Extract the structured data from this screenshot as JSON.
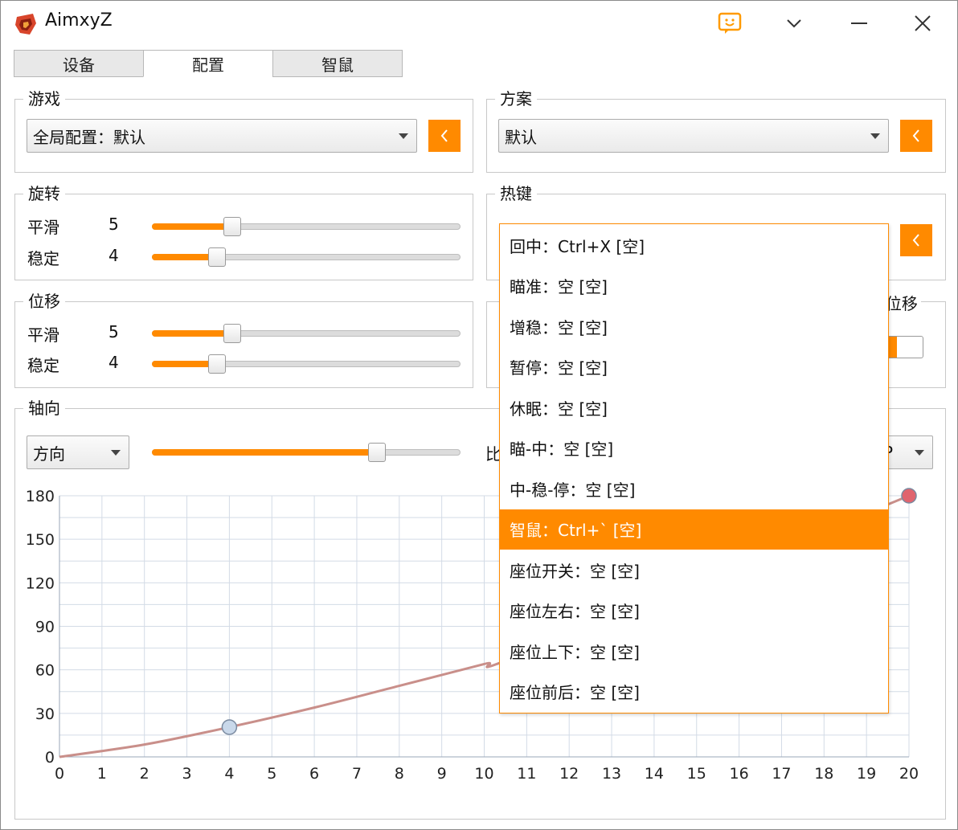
{
  "app": {
    "title": "AimxyZ"
  },
  "tabs": [
    {
      "label": "设备",
      "active": false
    },
    {
      "label": "配置",
      "active": true
    },
    {
      "label": "智鼠",
      "active": false
    }
  ],
  "game": {
    "title": "游戏",
    "selected": "全局配置：默认"
  },
  "scheme": {
    "title": "方案",
    "selected": "默认"
  },
  "rotation": {
    "title": "旋转",
    "rows": [
      {
        "label": "平滑",
        "value": "5",
        "fraction": 0.26
      },
      {
        "label": "稳定",
        "value": "4",
        "fraction": 0.21
      }
    ]
  },
  "hotkeys": {
    "title": "热键"
  },
  "displacement": {
    "title": "位移",
    "rows": [
      {
        "label": "平滑",
        "value": "5",
        "fraction": 0.26
      },
      {
        "label": "稳定",
        "value": "4",
        "fraction": 0.21
      }
    ]
  },
  "hidden_group": {
    "partial_title": "t位移"
  },
  "axis": {
    "title": "轴向",
    "mode": "方向",
    "slider_fraction": 0.73,
    "ratio_label_partial": "比",
    "right_combo_partial": "P"
  },
  "hotkey_list": {
    "selected_index": 7,
    "items": [
      "回中：Ctrl+X [空]",
      "瞄准：空 [空]",
      "增稳：空 [空]",
      "暂停：空 [空]",
      "休眠：空 [空]",
      "瞄-中：空 [空]",
      "中-稳-停：空 [空]",
      "智鼠：Ctrl+` [空]",
      "座位开关：空 [空]",
      "座位左右：空 [空]",
      "座位上下：空 [空]",
      "座位前后：空 [空]"
    ]
  },
  "chart_data": {
    "type": "line",
    "x_ticks": [
      "0",
      "1",
      "2",
      "3",
      "4",
      "5",
      "6",
      "7",
      "8",
      "9",
      "10",
      "11",
      "12",
      "13",
      "14",
      "15",
      "16",
      "17",
      "18",
      "19",
      "20"
    ],
    "y_ticks": [
      "0",
      "30",
      "60",
      "90",
      "120",
      "150",
      "180"
    ],
    "xlim": [
      0,
      20
    ],
    "ylim": [
      0,
      180
    ],
    "grid": true,
    "series": [
      {
        "color": "#c98f8a",
        "x": [
          0,
          2,
          4,
          6,
          8,
          10,
          11,
          20
        ],
        "y": [
          0,
          8.5,
          20.5,
          34,
          49,
          64,
          72,
          180
        ]
      }
    ],
    "control_points": [
      {
        "x": 4,
        "y": 20.5,
        "color": "#c9d8ea"
      },
      {
        "x": 20,
        "y": 180,
        "color": "#e0646e"
      }
    ]
  },
  "colors": {
    "accent": "#ff8a00"
  }
}
